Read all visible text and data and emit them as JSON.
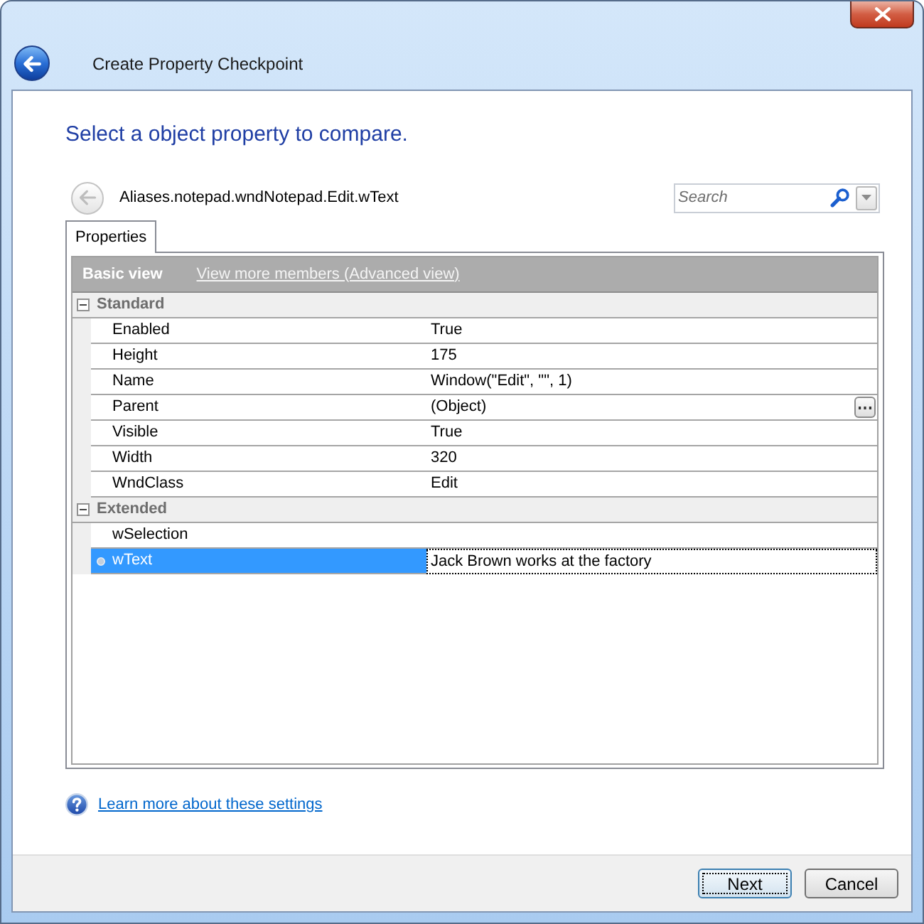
{
  "window": {
    "title": "Create Property Checkpoint",
    "back_button": {
      "disabled": false
    }
  },
  "heading": "Select a object property to compare.",
  "object_bar": {
    "path": "Aliases.notepad.wndNotepad.Edit.wText",
    "back_button": {
      "disabled": true
    }
  },
  "search": {
    "placeholder": "Search"
  },
  "tabs": [
    {
      "label": "Properties",
      "selected": true
    }
  ],
  "grid": {
    "views": [
      {
        "label": "Basic view",
        "selected": true
      },
      {
        "label": "View more members (Advanced view)",
        "selected": false
      }
    ],
    "categories": [
      {
        "name": "Standard",
        "expanded": true,
        "properties": [
          {
            "name": "Enabled",
            "value": "True",
            "kind": "text",
            "selected": false
          },
          {
            "name": "Height",
            "value": "175",
            "kind": "text",
            "selected": false
          },
          {
            "name": "Name",
            "value": "Window(\"Edit\", \"\", 1)",
            "kind": "text",
            "selected": false
          },
          {
            "name": "Parent",
            "value": "(Object)",
            "kind": "object",
            "selected": false
          },
          {
            "name": "Visible",
            "value": "True",
            "kind": "text",
            "selected": false
          },
          {
            "name": "Width",
            "value": "320",
            "kind": "text",
            "selected": false
          },
          {
            "name": "WndClass",
            "value": "Edit",
            "kind": "text",
            "selected": false
          }
        ]
      },
      {
        "name": "Extended",
        "expanded": true,
        "properties": [
          {
            "name": "wSelection",
            "kind": "text",
            "selected": false
          },
          {
            "name": "wText",
            "value": "Jack Brown works at the factory",
            "kind": "text",
            "selected": true
          }
        ]
      }
    ]
  },
  "help_link": "Learn more about these settings",
  "buttons": [
    {
      "label": "Next",
      "default": true
    },
    {
      "label": "Cancel",
      "default": false
    }
  ]
}
